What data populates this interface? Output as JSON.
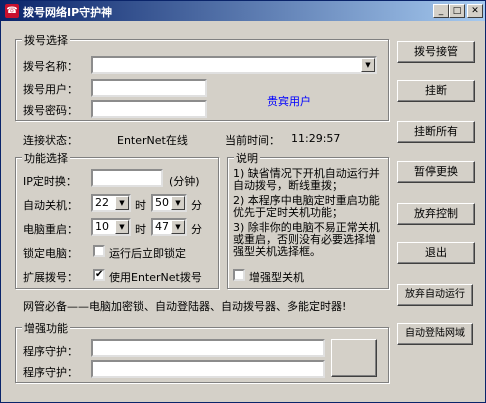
{
  "window": {
    "title": "拨号网络IP守护神"
  },
  "dial": {
    "group_title": "拨号选择",
    "name_label": "拨号名称：",
    "name_value": "",
    "user_label": "拨号用户：",
    "user_value": "",
    "pass_label": "拨号密码：",
    "pass_value": "",
    "guest_text": "贵宾用户"
  },
  "status": {
    "conn_label": "连接状态：",
    "conn_value": "EnterNet在线",
    "time_label": "当前时间：",
    "time_value": "11:29:57"
  },
  "func": {
    "group_title": "功能选择",
    "ip_label": "IP定时换：",
    "ip_unit": "(分钟)",
    "shutdown_label": "自动关机：",
    "shutdown_hour": "22",
    "shutdown_min": "50",
    "restart_label": "电脑重启：",
    "restart_hour": "10",
    "restart_min": "47",
    "hour_unit": "时",
    "min_unit": "分",
    "lock_label": "锁定电脑：",
    "lock_option": "运行后立即锁定",
    "ext_label": "扩展拨号：",
    "ext_option": "使用EnterNet拨号"
  },
  "notes": {
    "group_title": "说明",
    "n1": "1) 缺省情况下开机自动运行并自动拨号，断线重拨；",
    "n2": "2) 本程序中电脑定时重启功能优先于定时关机功能；",
    "n3": "3) 除非你的电脑不易正常关机或重启，否则没有必要选择增强型关机选择框。",
    "enhanced_option": "增强型关机"
  },
  "promo": "网管必备——电脑加密锁、自动登陆器、自动拨号器、多能定时器!",
  "guard": {
    "group_title": "增强功能",
    "p1_label": "程序守护：",
    "p2_label": "程序守护："
  },
  "buttons": {
    "dial_control": "拨号接管",
    "hangup": "挂断",
    "hangup_all": "挂断所有",
    "pause": "暂停更换",
    "abandon": "放弃控制",
    "exit": "退出",
    "abandon_autorun": "放弃自动运行",
    "auto_login": "自动登陆网域"
  },
  "colors": {
    "title_start": "#0a246a",
    "title_end": "#a6caf0",
    "guest_text": "#0000ff"
  }
}
